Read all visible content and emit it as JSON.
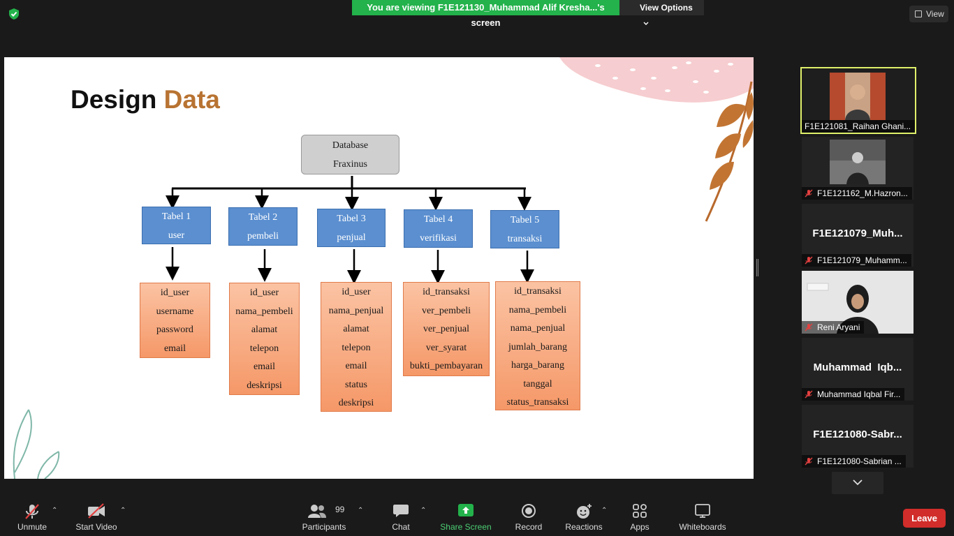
{
  "topbar": {
    "viewing_label": "You are viewing F1E121130_Muhammad Alif Kresha...'s screen",
    "view_options_label": "View Options",
    "view_label": "View"
  },
  "slide": {
    "title_part1": "Design ",
    "title_part2": "Data",
    "database": [
      "Database",
      "Fraxinus"
    ],
    "tables": [
      {
        "name": "Tabel 1",
        "sub": "user",
        "fields": [
          "id_user",
          "username",
          "password",
          "email"
        ]
      },
      {
        "name": "Tabel 2",
        "sub": "pembeli",
        "fields": [
          "id_user",
          "nama_pembeli",
          "alamat",
          "telepon",
          "email",
          "deskripsi"
        ]
      },
      {
        "name": "Tabel 3",
        "sub": "penjual",
        "fields": [
          "id_user",
          "nama_penjual",
          "alamat",
          "telepon",
          "email",
          "status",
          "deskripsi"
        ]
      },
      {
        "name": "Tabel 4",
        "sub": "verifikasi",
        "fields": [
          "id_transaksi",
          "ver_pembeli",
          "ver_penjual",
          "ver_syarat",
          "bukti_pembayaran"
        ]
      },
      {
        "name": "Tabel 5",
        "sub": "transaksi",
        "fields": [
          "id_transaksi",
          "nama_pembeli",
          "nama_penjual",
          "jumlah_barang",
          "harga_barang",
          "tanggal",
          "status_transaksi"
        ]
      }
    ]
  },
  "participants": [
    {
      "name": "F1E121081_Raihan Ghani...",
      "video": true,
      "muted": false
    },
    {
      "name": "F1E121162_M.Hazron...",
      "video": true,
      "muted": true
    },
    {
      "big": "F1E121079_Muh...",
      "name": "F1E121079_Muhamm...",
      "video": false,
      "muted": true
    },
    {
      "name": "Reni Aryani",
      "video": true,
      "muted": true
    },
    {
      "big": "Muhammad  Iqb...",
      "name": "Muhammad Iqbal Fir...",
      "video": false,
      "muted": true
    },
    {
      "big": "F1E121080-Sabr...",
      "name": "F1E121080-Sabrian ...",
      "video": false,
      "muted": true
    }
  ],
  "toolbar": {
    "unmute": "Unmute",
    "start_video": "Start Video",
    "participants": "Participants",
    "participants_count": "99",
    "chat": "Chat",
    "share_screen": "Share Screen",
    "record": "Record",
    "reactions": "Reactions",
    "apps": "Apps",
    "whiteboards": "Whiteboards",
    "leave": "Leave"
  },
  "colors": {
    "share_green": "#23b24b",
    "leave_red": "#d12d2a",
    "title_accent": "#b87332",
    "active_speaker": "#dff06a"
  }
}
